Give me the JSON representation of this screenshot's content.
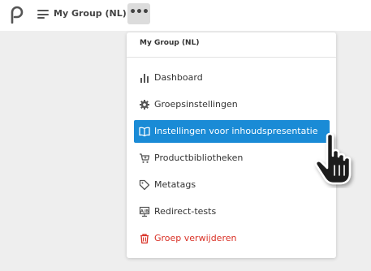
{
  "header": {
    "logo_icon": "logo-p-icon",
    "menu_icon": "hamburger-icon",
    "group_name": "My Group (NL)",
    "more_label": "•••"
  },
  "dropdown": {
    "title": "My Group (NL)",
    "items": [
      {
        "label": "Dashboard",
        "icon": "bar-chart-icon"
      },
      {
        "label": "Groepsinstellingen",
        "icon": "gear-icon"
      },
      {
        "label": "Instellingen voor inhoudspresentatie",
        "icon": "book-open-icon",
        "active": true
      },
      {
        "label": "Productbibliotheken",
        "icon": "cart-icon"
      },
      {
        "label": "Metatags",
        "icon": "tag-icon"
      },
      {
        "label": "Redirect-tests",
        "icon": "ab-test-icon"
      },
      {
        "label": "Groep verwijderen",
        "icon": "trash-icon",
        "danger": true
      }
    ]
  },
  "colors": {
    "accent": "#1a8bd6",
    "danger": "#d93025",
    "background": "#eeeeee"
  },
  "cursor_icon": "hand-pointer-icon"
}
